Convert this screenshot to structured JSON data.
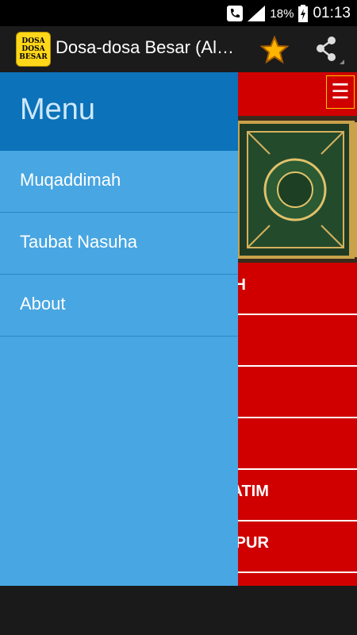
{
  "status_bar": {
    "battery_percent": "18%",
    "time": "01:13"
  },
  "action_bar": {
    "app_icon_lines": [
      "DOSA",
      "DOSA",
      "BESAR"
    ],
    "title": "Dosa-dosa Besar (Al…"
  },
  "background_list": {
    "items": [
      "OH",
      "",
      "",
      "",
      "YATIM",
      "MPUR"
    ]
  },
  "drawer": {
    "title": "Menu",
    "items": [
      {
        "label": "Muqaddimah"
      },
      {
        "label": "Taubat Nasuha"
      },
      {
        "label": "About"
      }
    ]
  },
  "colors": {
    "drawer_header": "#0c72b9",
    "drawer_body": "#48a6e2",
    "content_red": "#d00000",
    "action_bar": "#1b1b1b"
  },
  "icons": [
    "phone-call-icon",
    "signal-icon",
    "battery-charging-icon",
    "star-icon",
    "share-icon",
    "hamburger-menu-icon"
  ]
}
